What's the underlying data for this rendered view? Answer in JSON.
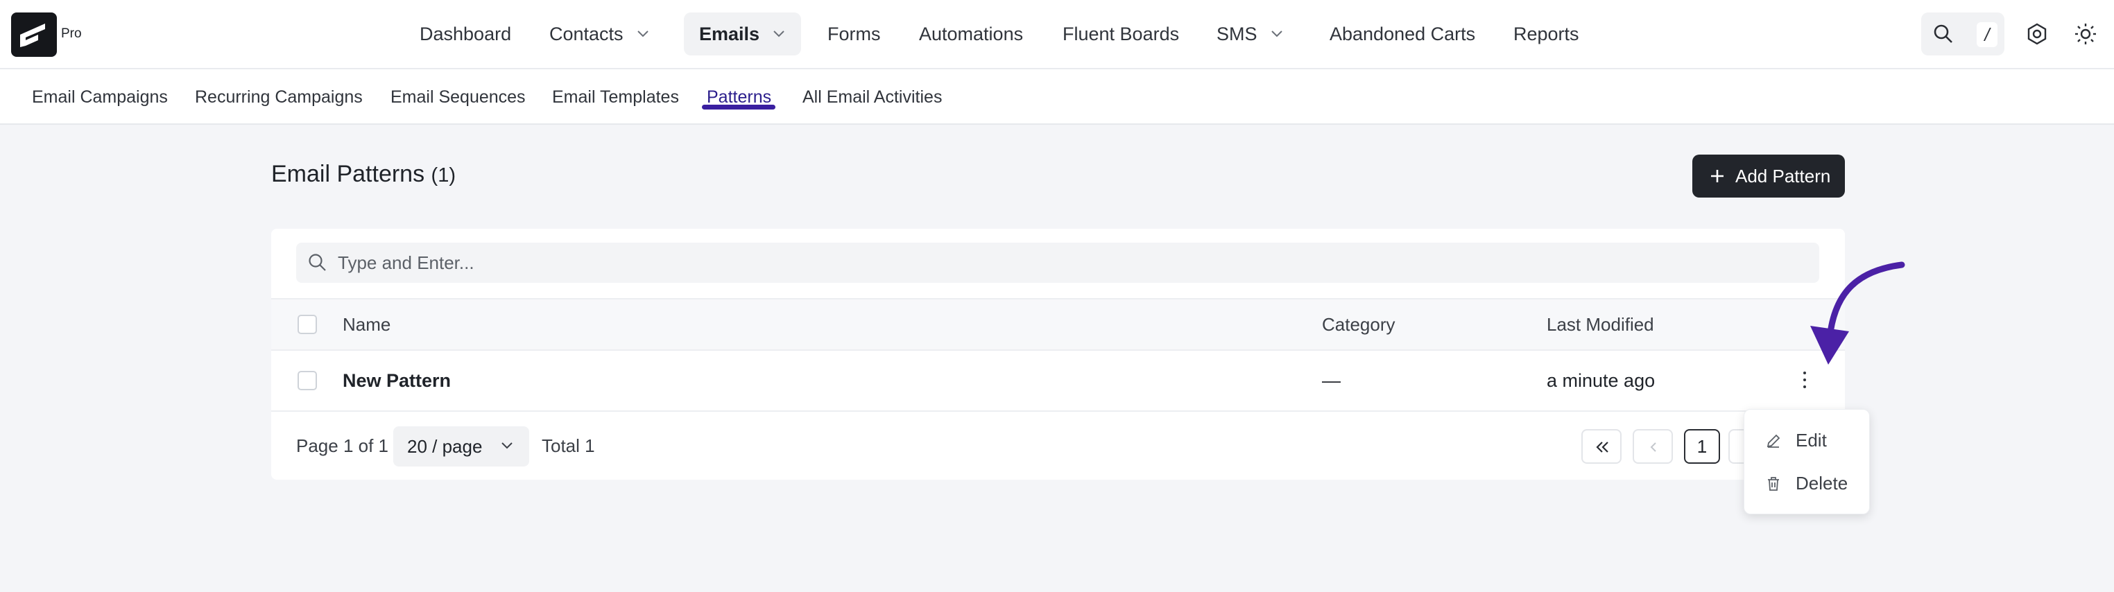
{
  "app": {
    "logo_badge": "Pro"
  },
  "nav": {
    "items": [
      {
        "label": "Dashboard"
      },
      {
        "label": "Contacts"
      },
      {
        "label": "Emails"
      },
      {
        "label": "Forms"
      },
      {
        "label": "Automations"
      },
      {
        "label": "Fluent Boards"
      },
      {
        "label": "SMS"
      },
      {
        "label": "Abandoned Carts"
      },
      {
        "label": "Reports"
      }
    ],
    "search_shortcut": "/"
  },
  "subnav": {
    "items": [
      {
        "label": "Email Campaigns"
      },
      {
        "label": "Recurring Campaigns"
      },
      {
        "label": "Email Sequences"
      },
      {
        "label": "Email Templates"
      },
      {
        "label": "Patterns"
      },
      {
        "label": "All Email Activities"
      }
    ],
    "active": "Patterns"
  },
  "page": {
    "title": "Email Patterns",
    "count": "(1)",
    "add_button": "Add Pattern"
  },
  "search": {
    "placeholder": "Type and Enter..."
  },
  "table": {
    "columns": {
      "name": "Name",
      "category": "Category",
      "modified": "Last Modified"
    },
    "rows": [
      {
        "name": "New Pattern",
        "category": "—",
        "modified": "a minute ago"
      }
    ]
  },
  "pagination": {
    "page_info": "Page 1 of 1",
    "per_page": "20 / page",
    "total": "Total 1",
    "current": "1"
  },
  "row_menu": {
    "edit": "Edit",
    "delete": "Delete"
  },
  "colors": {
    "accent": "#3a1fa0",
    "dark_button": "#22252b",
    "annotation_arrow": "#4b21a6"
  }
}
